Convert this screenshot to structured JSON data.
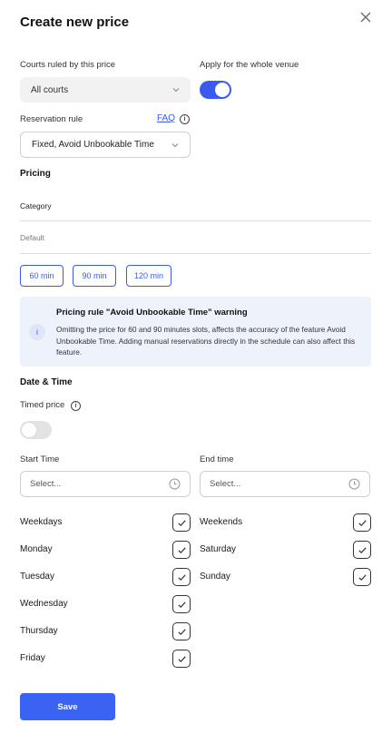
{
  "title": "Create new price",
  "courts": {
    "label": "Courts ruled by this price",
    "value": "All courts"
  },
  "venue": {
    "label": "Apply for the whole venue",
    "enabled": true
  },
  "reservation": {
    "label": "Reservation rule",
    "faq": "FAQ",
    "value": "Fixed, Avoid Unbookable Time"
  },
  "pricing": {
    "title": "Pricing",
    "category_label": "Category",
    "category_value": "Default",
    "durations": [
      "60 min",
      "90 min",
      "120 min"
    ]
  },
  "warning": {
    "icon": "info-icon",
    "title": "Pricing rule \"Avoid Unbookable Time\" warning",
    "text": "Omitting the price for 60 and 90 minutes slots, affects the accuracy of the feature Avoid Unbookable Time. Adding manual reservations directly in the schedule can also affect this feature."
  },
  "datetime": {
    "title": "Date & Time",
    "timed_label": "Timed price",
    "timed_enabled": false,
    "start_label": "Start Time",
    "start_placeholder": "Select...",
    "end_label": "End time",
    "end_placeholder": "Select..."
  },
  "days_left": [
    {
      "label": "Weekdays",
      "checked": true
    },
    {
      "label": "Monday",
      "checked": true
    },
    {
      "label": "Tuesday",
      "checked": true
    },
    {
      "label": "Wednesday",
      "checked": true
    },
    {
      "label": "Thursday",
      "checked": true
    },
    {
      "label": "Friday",
      "checked": true
    }
  ],
  "days_right": [
    {
      "label": "Weekends",
      "checked": true
    },
    {
      "label": "Saturday",
      "checked": true
    },
    {
      "label": "Sunday",
      "checked": true
    }
  ],
  "save_label": "Save",
  "colors": {
    "accent": "#3b5bf0",
    "warning_bg": "#eef3fb"
  }
}
